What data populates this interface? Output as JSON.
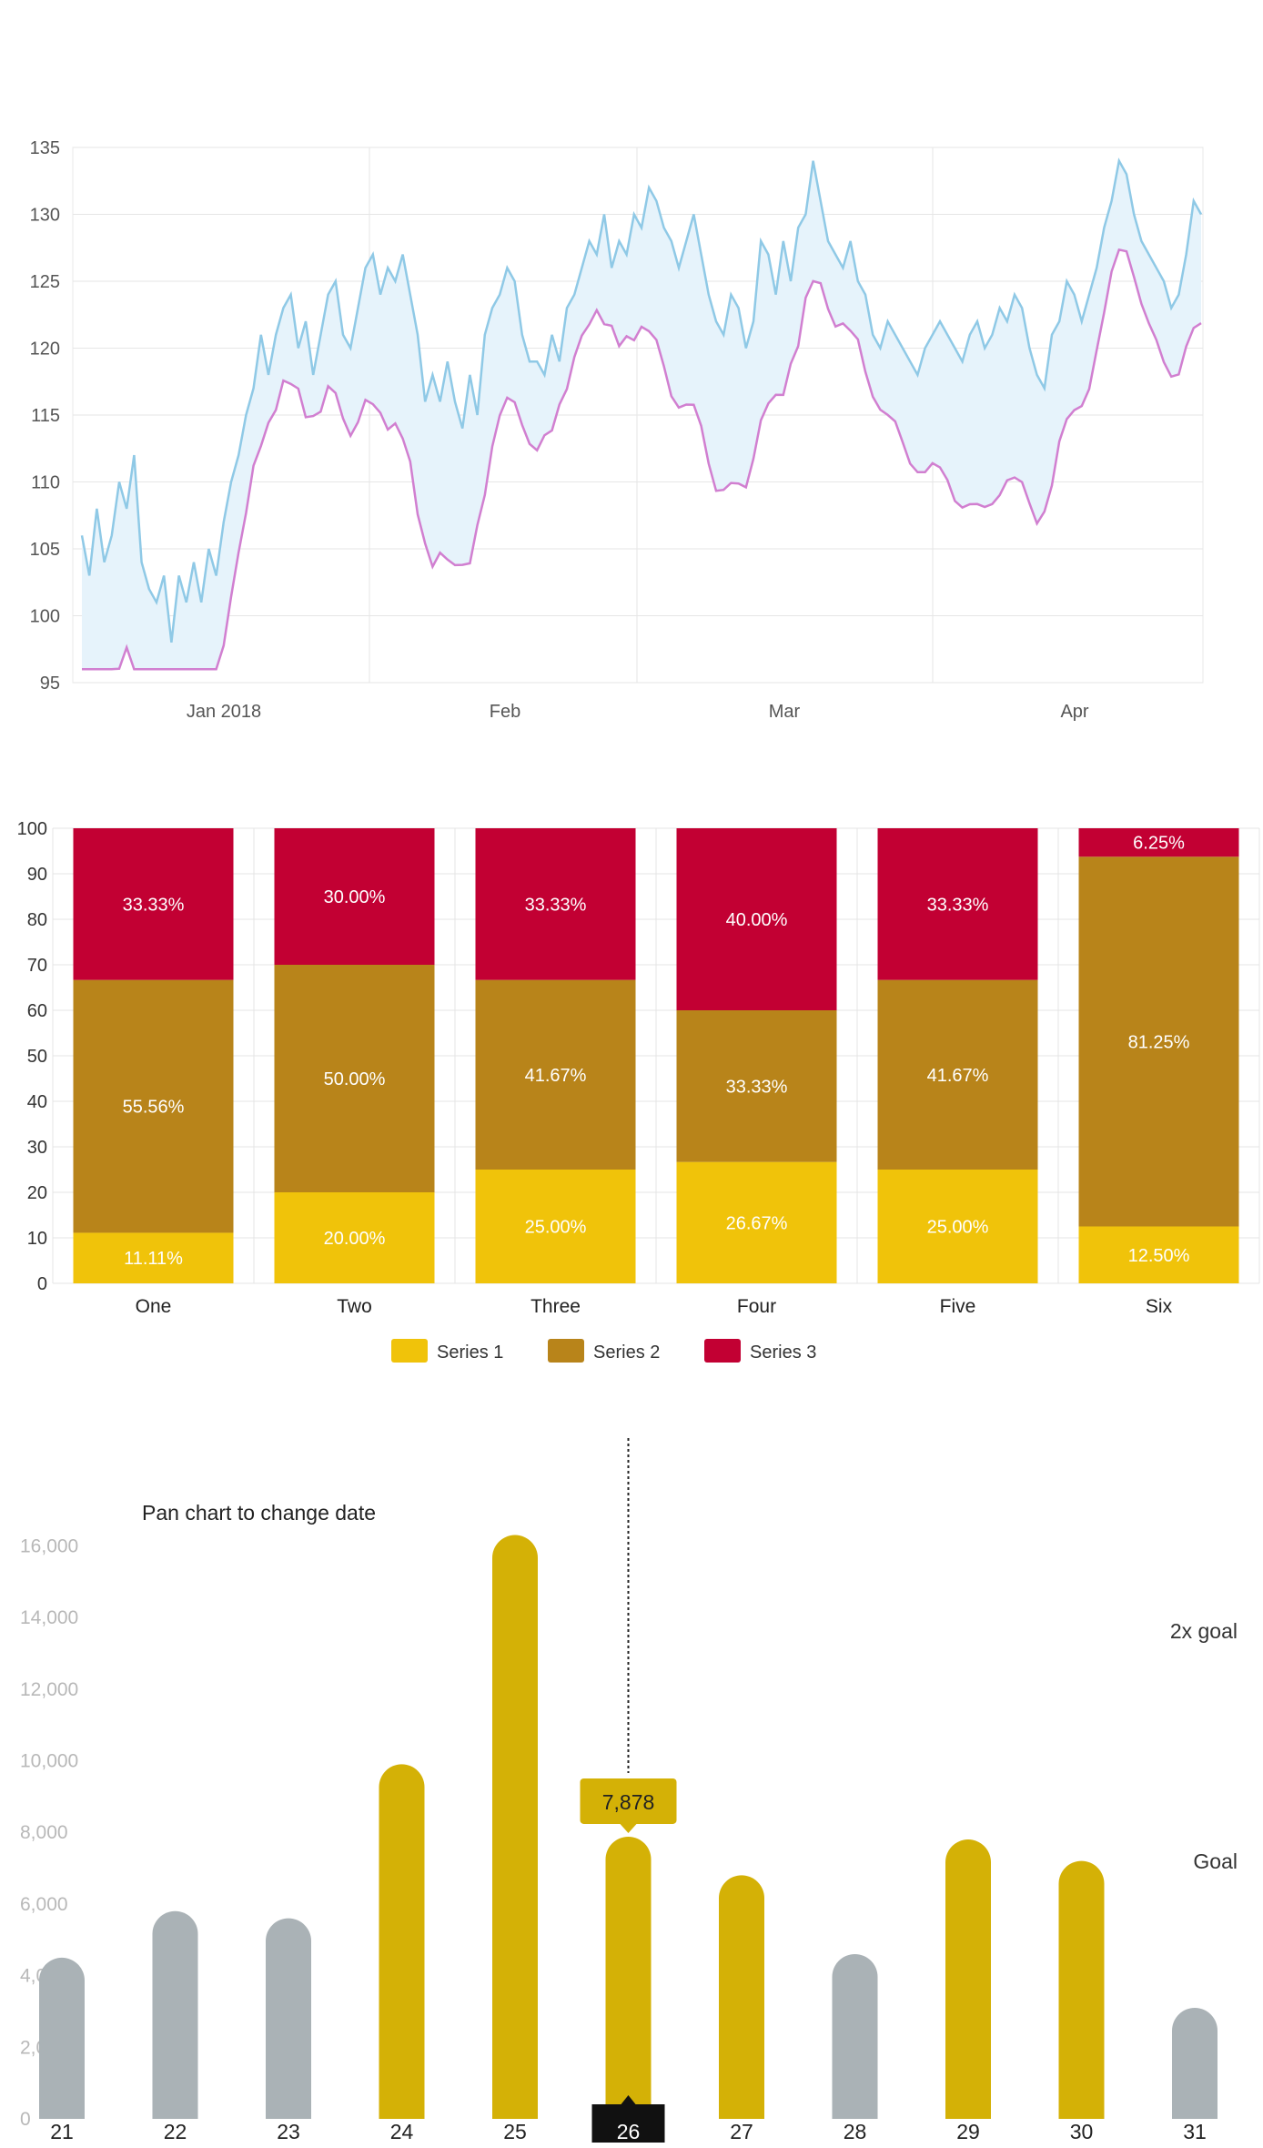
{
  "chart_data": [
    {
      "type": "area",
      "x_ticks": [
        "Jan 2018",
        "Feb",
        "Mar",
        "Apr"
      ],
      "ylim": [
        95,
        135
      ],
      "y_ticks": [
        95,
        100,
        105,
        110,
        115,
        120,
        125,
        130,
        135
      ],
      "grid": true,
      "colors": {
        "upper": "#8fc9e6",
        "lower": "#d17fd0",
        "fill": "#e6f3fb"
      },
      "upper": [
        106,
        103,
        108,
        104,
        106,
        110,
        108,
        112,
        104,
        102,
        101,
        103,
        98,
        103,
        101,
        104,
        101,
        105,
        103,
        107,
        110,
        112,
        115,
        117,
        121,
        118,
        121,
        123,
        124,
        120,
        122,
        118,
        121,
        124,
        125,
        121,
        120,
        123,
        126,
        127,
        124,
        126,
        125,
        127,
        124,
        121,
        116,
        118,
        116,
        119,
        116,
        114,
        118,
        115,
        121,
        123,
        124,
        126,
        125,
        121,
        119,
        119,
        118,
        121,
        119,
        123,
        124,
        126,
        128,
        127,
        130,
        126,
        128,
        127,
        130,
        129,
        132,
        131,
        129,
        128,
        126,
        128,
        130,
        127,
        124,
        122,
        121,
        124,
        123,
        120,
        122,
        128,
        127,
        124,
        128,
        125,
        129,
        130,
        134,
        131,
        128,
        127,
        126,
        128,
        125,
        124,
        121,
        120,
        122,
        121,
        120,
        119,
        118,
        120,
        121,
        122,
        121,
        120,
        119,
        121,
        122,
        120,
        121,
        123,
        122,
        124,
        123,
        120,
        118,
        117,
        121,
        122,
        125,
        124,
        122,
        124,
        126,
        129,
        131,
        134,
        133,
        130,
        128,
        127,
        126,
        125,
        123,
        124,
        127,
        131,
        130
      ]
    },
    {
      "type": "bar",
      "stacked": true,
      "categories": [
        "One",
        "Two",
        "Three",
        "Four",
        "Five",
        "Six"
      ],
      "ylim": [
        0,
        100
      ],
      "y_ticks": [
        0,
        10,
        20,
        30,
        40,
        50,
        60,
        70,
        80,
        90,
        100
      ],
      "legend_position": "bottom",
      "series": [
        {
          "name": "Series 1",
          "color": "#f0c30a",
          "values": [
            11.11,
            20.0,
            25.0,
            26.67,
            25.0,
            12.5
          ],
          "labels": [
            "11.11%",
            "20.00%",
            "25.00%",
            "26.67%",
            "25.00%",
            "12.50%"
          ]
        },
        {
          "name": "Series 2",
          "color": "#b8841a",
          "values": [
            55.56,
            50.0,
            41.67,
            33.33,
            41.67,
            81.25
          ],
          "labels": [
            "55.56%",
            "50.00%",
            "41.67%",
            "33.33%",
            "41.67%",
            "81.25%"
          ]
        },
        {
          "name": "Series 3",
          "color": "#c20033",
          "values": [
            33.33,
            30.0,
            33.33,
            40.0,
            33.33,
            6.25
          ],
          "labels": [
            "33.33%",
            "30.00%",
            "33.33%",
            "40.00%",
            "33.33%",
            "6.25%"
          ]
        }
      ]
    },
    {
      "type": "bar",
      "categories": [
        "21",
        "22",
        "23",
        "24",
        "25",
        "26",
        "27",
        "28",
        "29",
        "30",
        "31"
      ],
      "values": [
        4500,
        5800,
        5600,
        9900,
        16300,
        7878,
        6800,
        4600,
        7800,
        7200,
        3100
      ],
      "above_goal": [
        false,
        false,
        false,
        true,
        true,
        true,
        true,
        false,
        true,
        true,
        false
      ],
      "selected_index": 5,
      "ylim": [
        0,
        17000
      ],
      "y_ticks": [
        "0",
        "2,000",
        "4,000",
        "6,000",
        "8,000",
        "10,000",
        "12,000",
        "14,000",
        "16,000"
      ],
      "annotation": "Pan chart to change date",
      "goal_label": "Goal",
      "goal2x_label": "2x goal",
      "tooltip": "7,878",
      "colors": {
        "active": "#d4b106",
        "inactive": "#aab2b6"
      }
    }
  ]
}
